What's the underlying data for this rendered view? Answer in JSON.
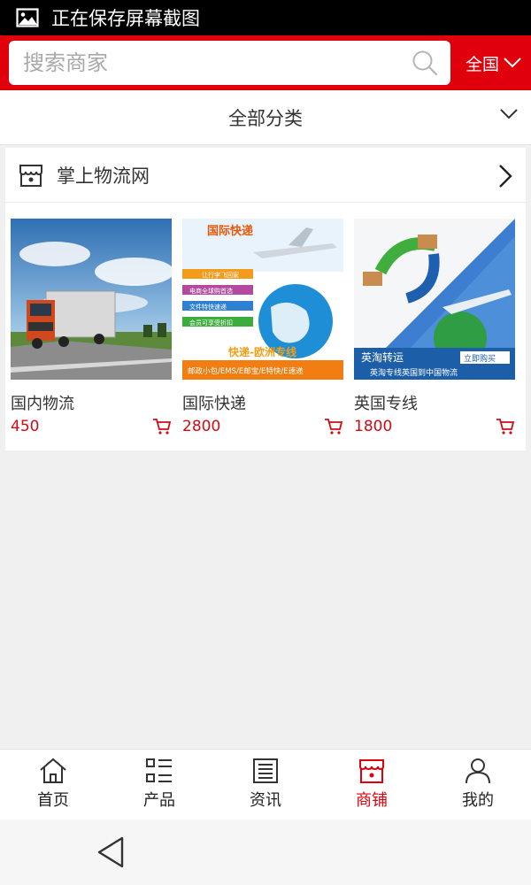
{
  "status_bar": {
    "text": "正在保存屏幕截图",
    "icon": "image-icon"
  },
  "header": {
    "search_placeholder": "搜索商家",
    "region_label": "全国",
    "accent_color": "#e0000c"
  },
  "category": {
    "label": "全部分类"
  },
  "store": {
    "name": "掌上物流网",
    "products": [
      {
        "name": "国内物流",
        "price": "450"
      },
      {
        "name": "国际快递",
        "price": "2800",
        "image_text": {
          "title": "国际快递",
          "lines": [
            "让行李飞回家",
            "电商全球购首选",
            "文件特快速递",
            "会员可享受折扣"
          ],
          "banner": "快递-欧洲专线",
          "sub": "邮政小包/EMS/E邮宝/E特快/E速递"
        }
      },
      {
        "name": "英国专线",
        "price": "1800",
        "image_text": {
          "title": "英淘转运",
          "button": "立即购买",
          "sub": "英淘专线英国到中国物流"
        }
      }
    ]
  },
  "bottom_nav": {
    "items": [
      {
        "label": "首页",
        "icon": "home-icon"
      },
      {
        "label": "产品",
        "icon": "list-icon"
      },
      {
        "label": "资讯",
        "icon": "news-icon"
      },
      {
        "label": "商铺",
        "icon": "store-icon",
        "active": true
      },
      {
        "label": "我的",
        "icon": "user-icon"
      }
    ]
  }
}
